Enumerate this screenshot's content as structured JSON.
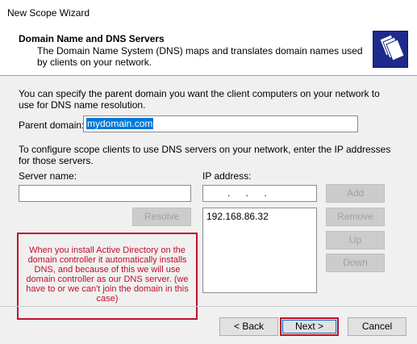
{
  "window": {
    "title": "New Scope Wizard"
  },
  "header": {
    "title": "Domain Name and DNS Servers",
    "subtitle": "The Domain Name System (DNS) maps and translates domain names used by clients on your network."
  },
  "intro": "You can specify the parent domain you want the client computers on your network to use for DNS name resolution.",
  "parent_domain": {
    "label": "Parent domain:",
    "value": "mydomain.com"
  },
  "configure_text": "To configure scope clients to use DNS servers on your network, enter the IP addresses for those servers.",
  "server_name": {
    "label": "Server name:",
    "value": ""
  },
  "ip_address": {
    "label": "IP address:",
    "value": ".   .   ."
  },
  "dns_servers": [
    "192.168.86.32"
  ],
  "buttons": {
    "resolve": "Resolve",
    "add": "Add",
    "remove": "Remove",
    "up": "Up",
    "down": "Down",
    "back": "< Back",
    "next": "Next >",
    "cancel": "Cancel"
  },
  "annotation": "When you install Active Directory on the domain controller it automatically installs DNS, and because of this we will use domain controller as our DNS server. (we have to or we can't join the domain in this case)",
  "colors": {
    "annotation": "#c0102a",
    "selection": "#0078d7"
  }
}
